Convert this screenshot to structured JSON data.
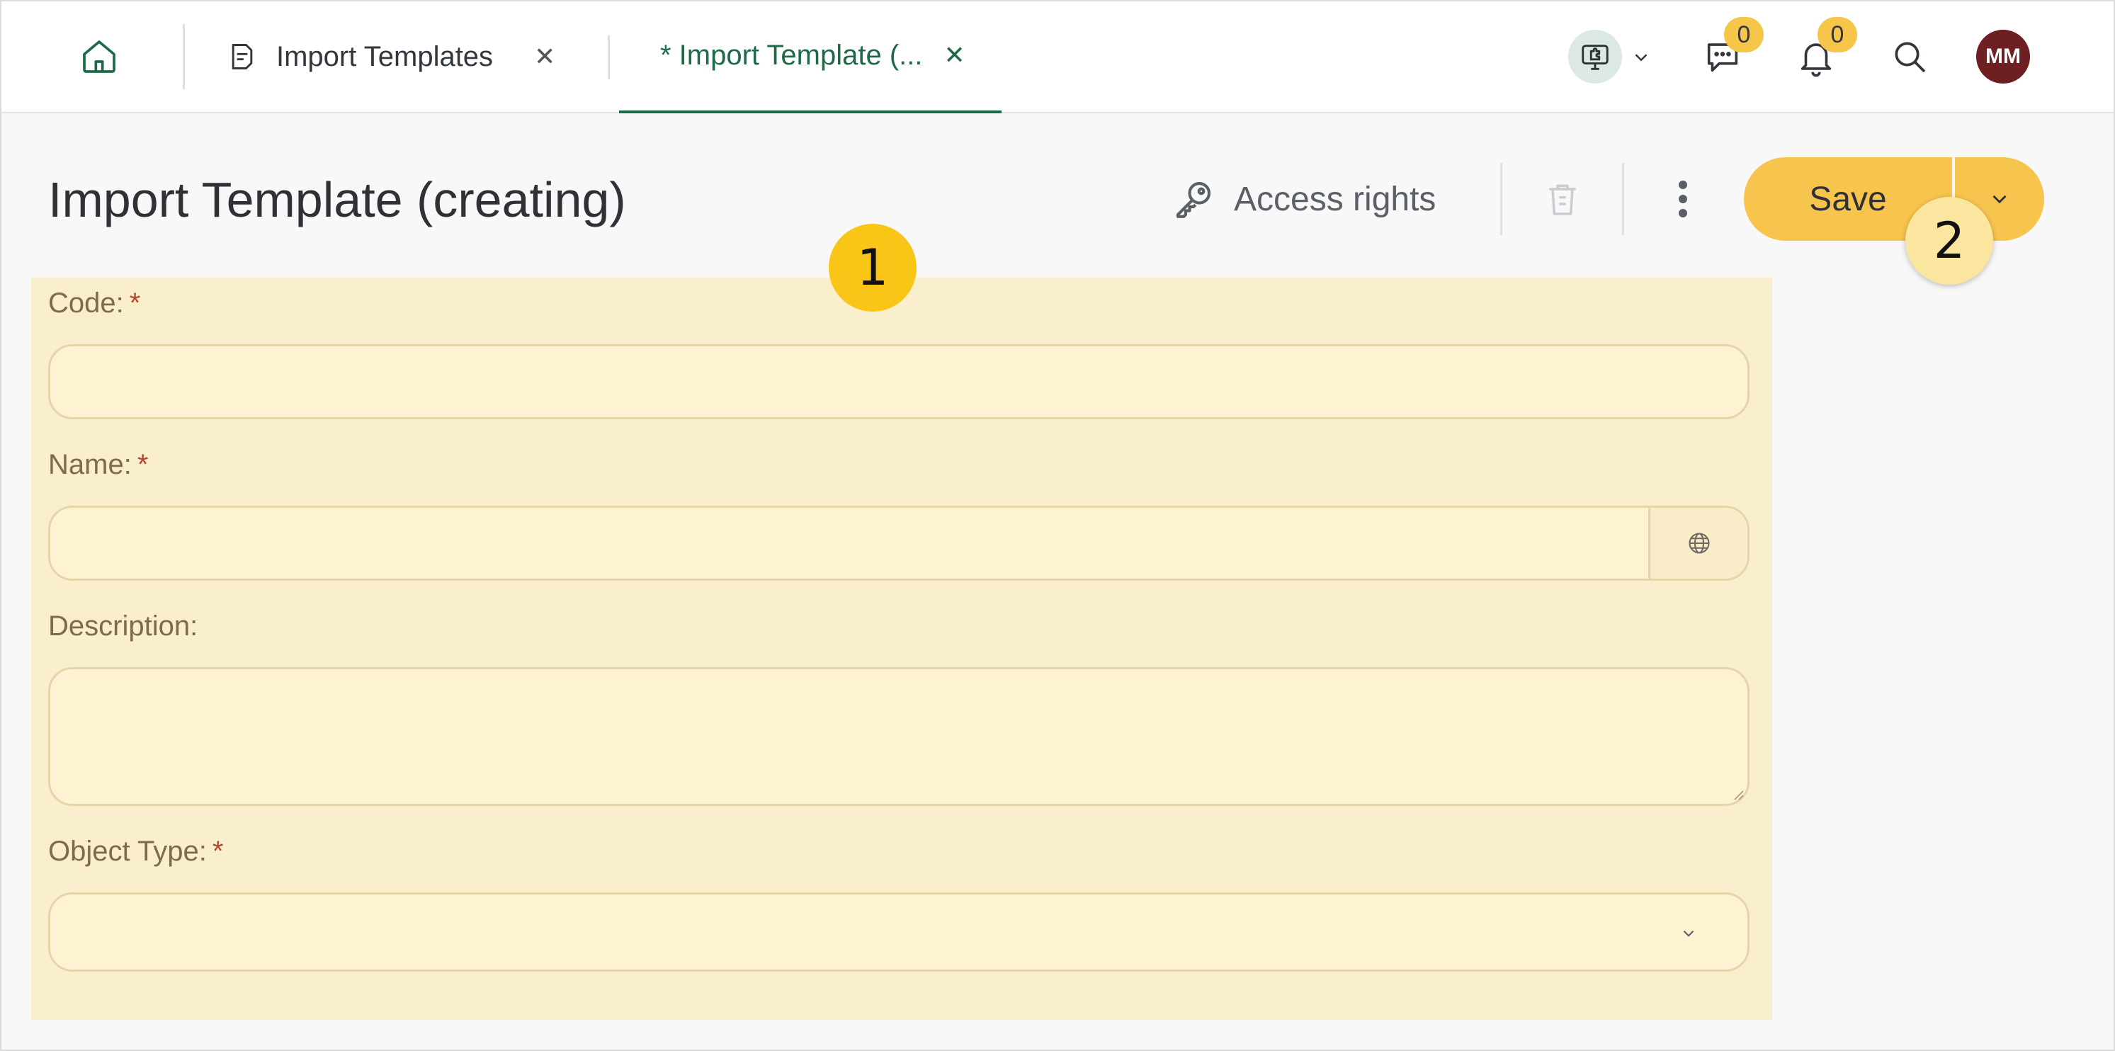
{
  "topbar": {
    "tabs": [
      {
        "label": "Import Templates",
        "close": "✕"
      },
      {
        "label": "* Import Template (...",
        "close": "✕"
      }
    ],
    "messages_badge": "0",
    "notifications_badge": "0",
    "avatar_initials": "MM"
  },
  "header": {
    "title": "Import Template (creating)",
    "access_rights": "Access rights",
    "save_label": "Save"
  },
  "markers": {
    "m1": "1",
    "m2": "2"
  },
  "form": {
    "code_label": "Code:",
    "name_label": "Name:",
    "description_label": "Description:",
    "object_type_label": "Object Type:",
    "required_mark": "*",
    "code_value": "",
    "name_value": "",
    "description_value": "",
    "object_type_value": ""
  },
  "colors": {
    "accent_green": "#1d6b46",
    "save_yellow": "#f7c54d",
    "badge_yellow": "#f6c64a",
    "avatar_red": "#6e1f22",
    "form_highlight": "#faefcc"
  }
}
